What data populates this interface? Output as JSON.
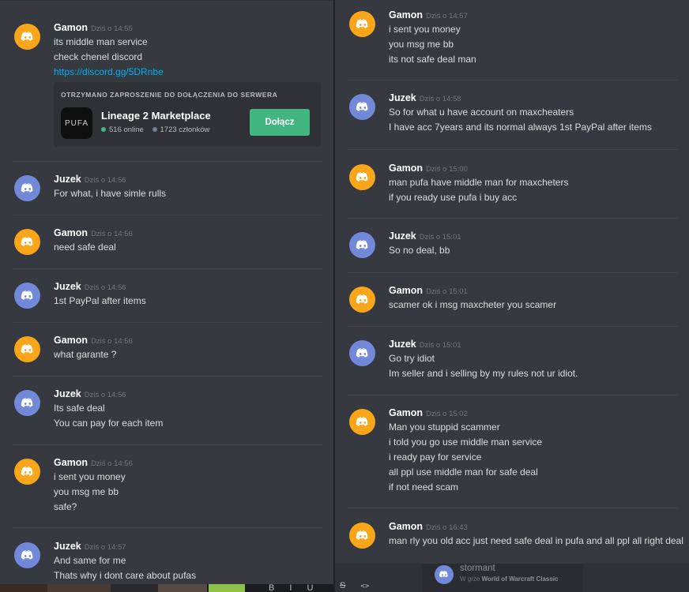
{
  "left": {
    "messages": [
      {
        "author": "Gamon",
        "time": "Dziś o 14:55",
        "avatar": "orange",
        "lines": [
          "its middle man service",
          "check chenel discord"
        ],
        "link": "https://discord.gg/5DRnbe"
      },
      {
        "author": "Juzek",
        "time": "Dziś o 14:56",
        "avatar": "blue",
        "lines": [
          "For what, i have simle rulls"
        ]
      },
      {
        "author": "Gamon",
        "time": "Dziś o 14:56",
        "avatar": "orange",
        "lines": [
          "need  safe deal"
        ]
      },
      {
        "author": "Juzek",
        "time": "Dziś o 14:56",
        "avatar": "blue",
        "lines": [
          "1st PayPal after items"
        ]
      },
      {
        "author": "Gamon",
        "time": "Dziś o 14:56",
        "avatar": "orange",
        "lines": [
          "what garante ?"
        ]
      },
      {
        "author": "Juzek",
        "time": "Dziś o 14:56",
        "avatar": "blue",
        "lines": [
          "Its safe deal",
          "You can pay for each item"
        ]
      },
      {
        "author": "Gamon",
        "time": "Dziś o 14:56",
        "avatar": "orange",
        "lines": [
          "i sent you money",
          "you msg me bb",
          "safe?"
        ]
      },
      {
        "author": "Juzek",
        "time": "Dziś o 14:57",
        "avatar": "blue",
        "lines": [
          "And same for me",
          "Thats why i dont care about pufas"
        ]
      }
    ],
    "invite": {
      "header": "OTRZYMANO ZAPROSZENIE DO DOŁĄCZENIA DO SERWERA",
      "icon_text": "PUFA",
      "server_name": "Lineage 2 Marketplace",
      "online": "516 online",
      "members": "1723 członków",
      "join_label": "Dołącz"
    }
  },
  "right": {
    "messages": [
      {
        "author": "Gamon",
        "time": "Dziś o 14:57",
        "avatar": "orange",
        "lines": [
          "i sent you money",
          "you msg me bb",
          "its not safe deal man"
        ]
      },
      {
        "author": "Juzek",
        "time": "Dziś o 14:58",
        "avatar": "blue",
        "lines": [
          "So for what u have account on maxcheaters",
          "I have acc 7years and its normal always 1st PayPal after items"
        ]
      },
      {
        "author": "Gamon",
        "time": "Dziś o 15:00",
        "avatar": "orange",
        "lines": [
          "man pufa have  middle man for maxcheters",
          "if you ready use pufa i buy acc"
        ]
      },
      {
        "author": "Juzek",
        "time": "Dziś o 15:01",
        "avatar": "blue",
        "lines": [
          "So no deal, bb"
        ]
      },
      {
        "author": "Gamon",
        "time": "Dziś o 15:01",
        "avatar": "orange",
        "lines": [
          "scamer ok i msg maxcheter you scamer"
        ]
      },
      {
        "author": "Juzek",
        "time": "Dziś o 15:01",
        "avatar": "blue",
        "lines": [
          "Go try idiot",
          "Im seller and i selling by my rules not ur idiot."
        ]
      },
      {
        "author": "Gamon",
        "time": "Dziś o 15:02",
        "avatar": "orange",
        "lines": [
          "Man you stuppid scammer",
          "i told you go use middle man service",
          "i ready pay for service",
          "all ppl use middle man for safe deal",
          "if not need scam"
        ]
      },
      {
        "author": "Gamon",
        "time": "Dziś o 16:43",
        "avatar": "orange",
        "lines": [
          "man rly you old acc just need safe deal in pufa and all ppl all right deal"
        ]
      }
    ]
  },
  "member": {
    "name": "stormant",
    "status_prefix": "W grze ",
    "status_game": "World of Warcraft Classic"
  },
  "toolbar": {
    "bold": "B",
    "italic": "I",
    "underline": "U",
    "strike": "S",
    "code": "<>"
  },
  "colors": {
    "orange": "#faa61a",
    "blue": "#7289da",
    "accept": "#43b581",
    "link": "#00b0f4"
  },
  "icons": {
    "avatar": "discord-logo-icon"
  }
}
